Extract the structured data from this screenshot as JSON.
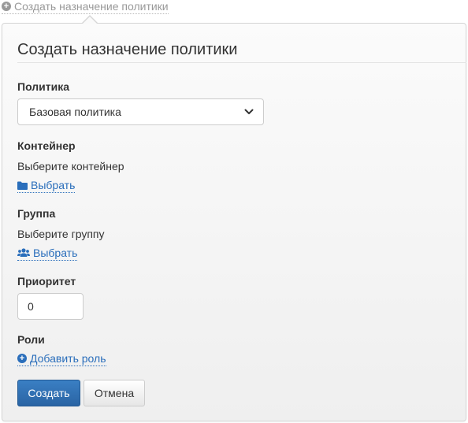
{
  "header_link": {
    "label": "Создать назначение политики",
    "icon": "plus-circle-icon"
  },
  "panel": {
    "title": "Создать назначение политики",
    "policy": {
      "label": "Политика",
      "selected": "Базовая политика"
    },
    "container": {
      "label": "Контейнер",
      "value": "Выберите контейнер",
      "link": "Выбрать",
      "icon": "folder-icon"
    },
    "group": {
      "label": "Группа",
      "value": "Выберите группу",
      "link": "Выбрать",
      "icon": "users-icon"
    },
    "priority": {
      "label": "Приоритет",
      "value": "0"
    },
    "roles": {
      "label": "Роли",
      "link": "Добавить роль",
      "icon": "plus-circle-icon"
    },
    "buttons": {
      "create": "Создать",
      "cancel": "Отмена"
    }
  },
  "colors": {
    "link": "#2a6ebb",
    "primary": "#2a64a4",
    "muted": "#999999"
  }
}
